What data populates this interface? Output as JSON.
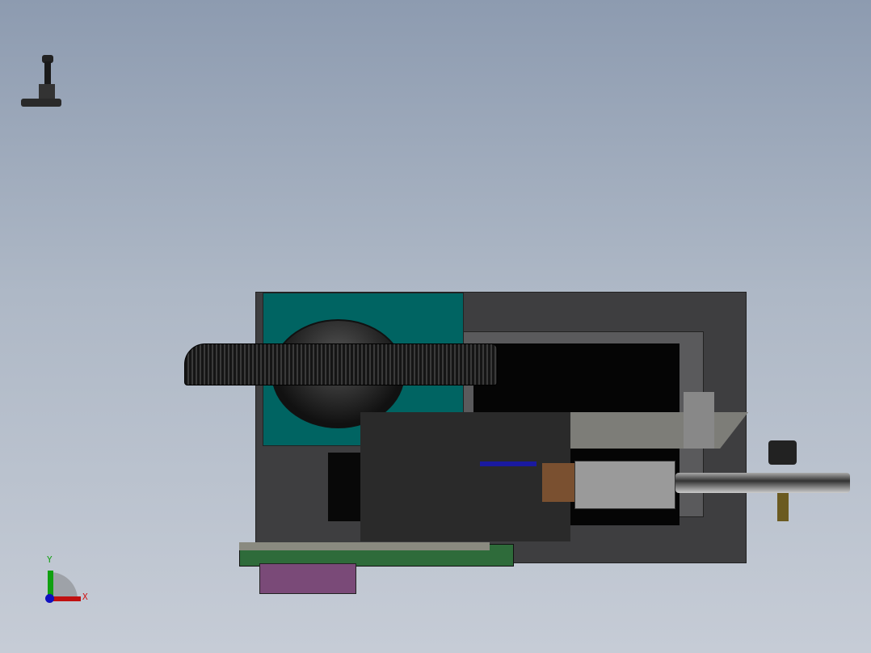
{
  "viewport": {
    "background_top": "#8d9bb0",
    "background_bottom": "#c6ccd6"
  },
  "triad": {
    "x_label": "X",
    "y_label": "Y",
    "x_color": "#d01010",
    "y_color": "#10a010",
    "z_color": "#1010c0"
  },
  "model": {
    "frame_color": "#3c3c3e",
    "panel_color": "#006060",
    "pcb_color": "#2e6b3a",
    "block_color": "#7a5030"
  }
}
